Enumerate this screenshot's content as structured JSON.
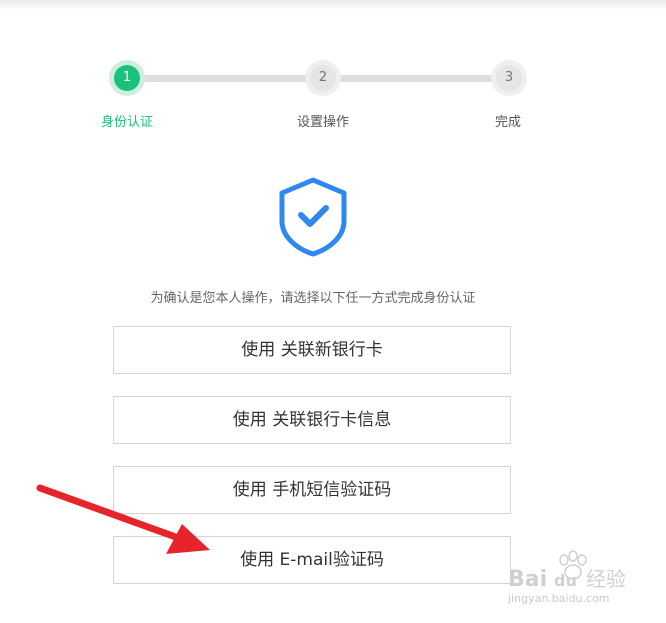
{
  "steps": [
    {
      "number": "1",
      "label": "身份认证",
      "state": "active"
    },
    {
      "number": "2",
      "label": "设置操作",
      "state": "pending"
    },
    {
      "number": "3",
      "label": "完成",
      "state": "pending"
    }
  ],
  "icon": "shield-check-icon",
  "prompt": "为确认是您本人操作，请选择以下任一方式完成身份认证",
  "options": [
    "使用 关联新银行卡",
    "使用 关联银行卡信息",
    "使用 手机短信验证码",
    "使用 E-mail验证码"
  ],
  "colors": {
    "accent": "#19c279",
    "shield": "#2f88f0",
    "arrow": "#e8242b"
  },
  "watermark": {
    "logo": "Bai du 经验",
    "url": "jingyan.baidu.com"
  }
}
